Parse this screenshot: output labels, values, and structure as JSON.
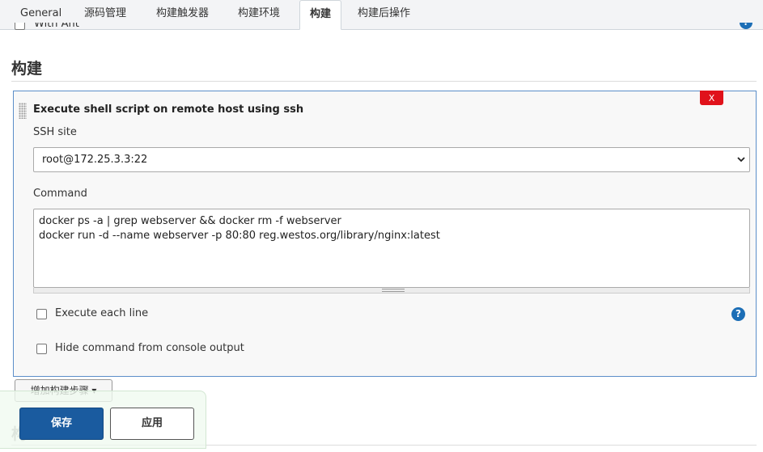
{
  "tabs": [
    {
      "label": "General",
      "active": false
    },
    {
      "label": "源码管理",
      "active": false
    },
    {
      "label": "构建触发器",
      "active": false
    },
    {
      "label": "构建环境",
      "active": false
    },
    {
      "label": "构建",
      "active": true
    },
    {
      "label": "构建后操作",
      "active": false
    }
  ],
  "prev_option": {
    "label": "With Ant",
    "help_icon": "question-circle-icon"
  },
  "section": {
    "title": "构建"
  },
  "build_step": {
    "title": "Execute shell script on remote host using ssh",
    "delete_label": "X",
    "ssh_site": {
      "label": "SSH site",
      "selected": "root@172.25.3.3:22"
    },
    "command": {
      "label": "Command",
      "value": "docker ps -a | grep webserver && docker rm -f webserver\ndocker run -d --name webserver -p 80:80 reg.westos.org/library/nginx:latest"
    },
    "options": [
      {
        "label": "Execute each line",
        "checked": false
      },
      {
        "label": "Hide command from console output",
        "checked": false
      }
    ],
    "help_icon": "question-circle-icon"
  },
  "add_step": {
    "label": "增加构建步骤 ▾"
  },
  "next_section": {
    "title": "构"
  },
  "actions": {
    "save_label": "保存",
    "apply_label": "应用"
  },
  "colors": {
    "primary": "#1a5b9f",
    "danger": "#e0121b",
    "help": "#1c6eb6",
    "panel_border": "#5b8ec9"
  }
}
